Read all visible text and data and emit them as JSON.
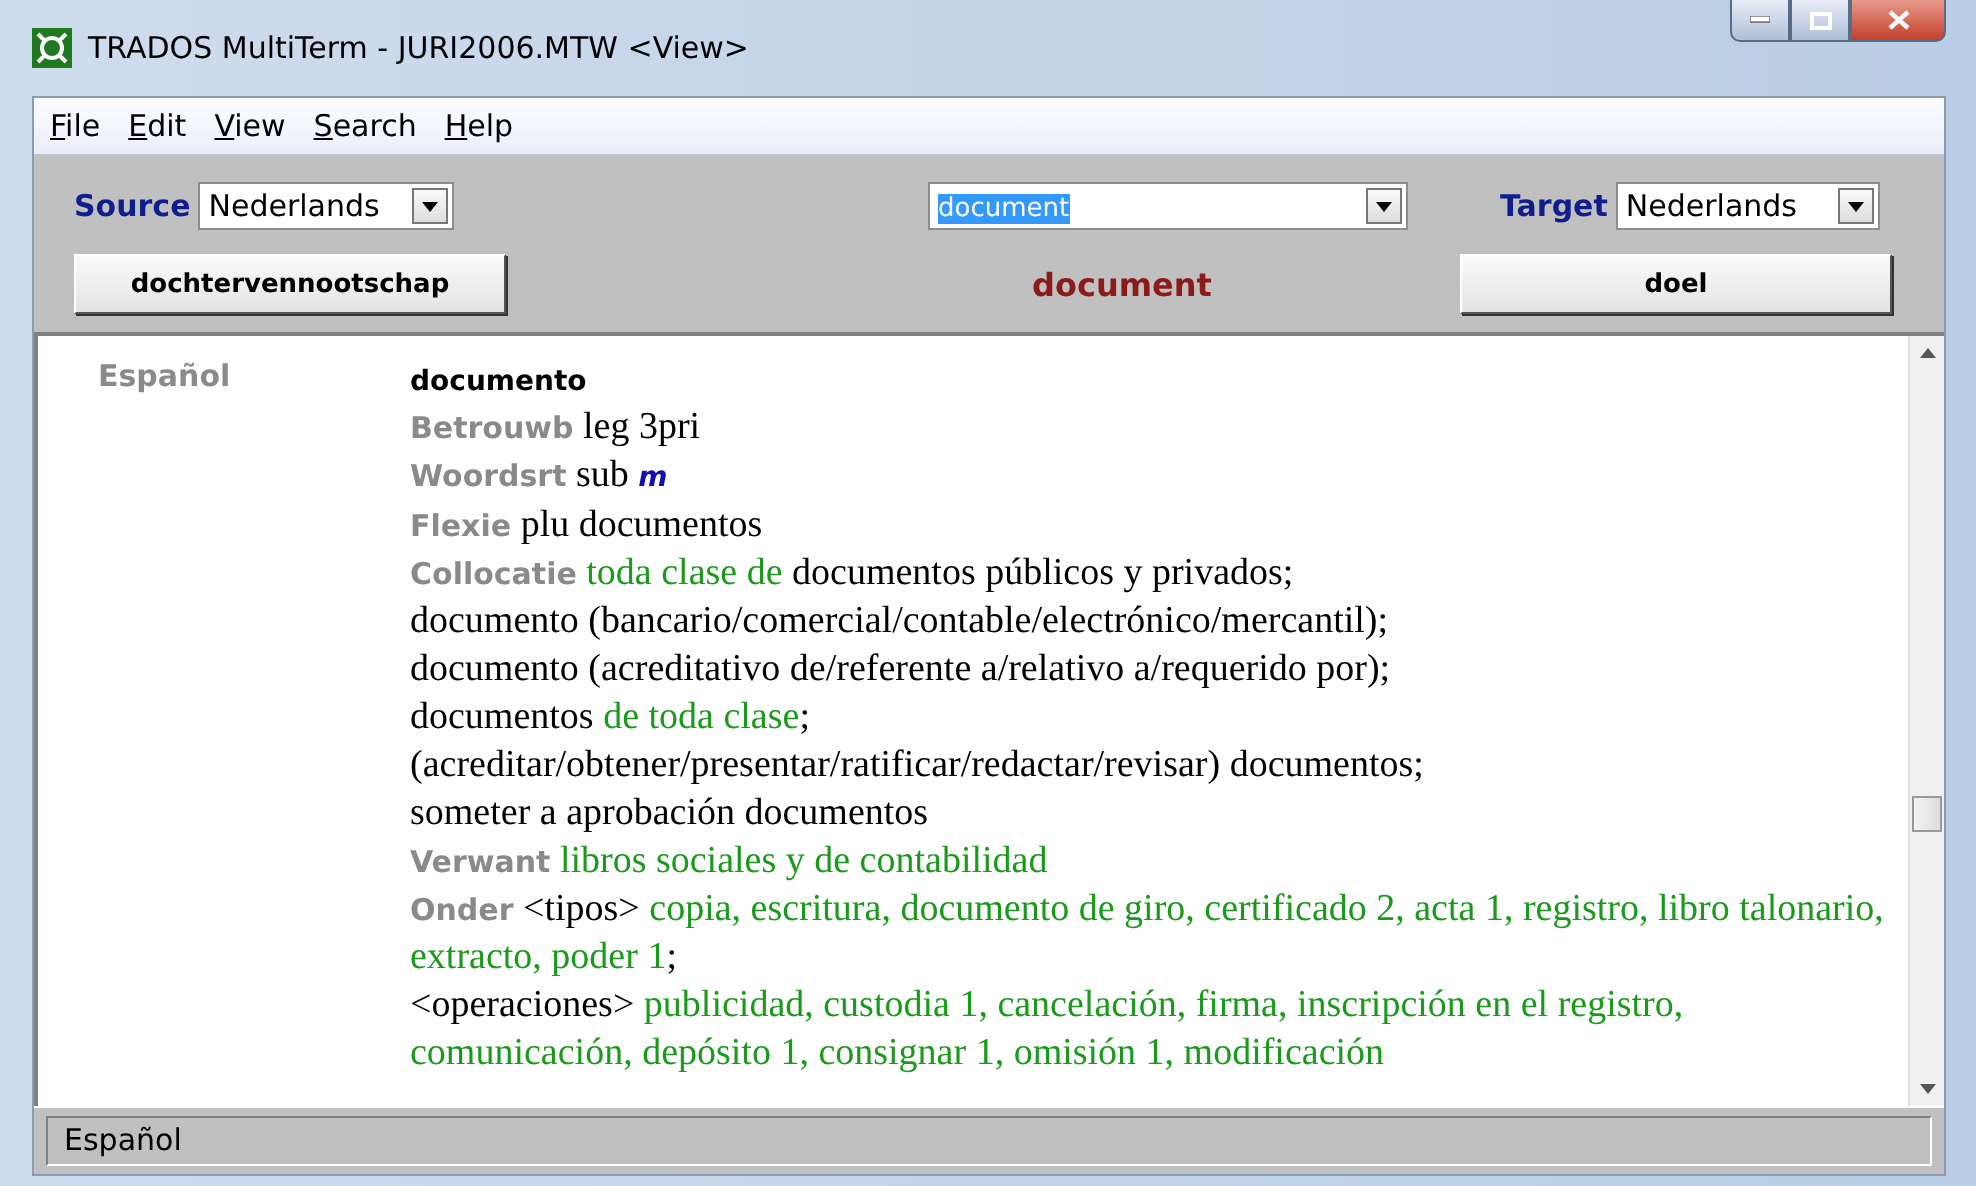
{
  "window": {
    "title": "TRADOS MultiTerm - JURI2006.MTW <View>"
  },
  "menu": [
    {
      "label": "File"
    },
    {
      "label": "Edit"
    },
    {
      "label": "View"
    },
    {
      "label": "Search"
    },
    {
      "label": "Help"
    }
  ],
  "toolbar": {
    "source_label": "Source",
    "source": "Nederlands",
    "search": "document",
    "target_label": "Target",
    "target": "Nederlands",
    "previous": "dochtervennootschap",
    "current": "document",
    "next": "doel"
  },
  "entry": {
    "language": "Español",
    "lines": [
      {
        "segments": [
          {
            "kind": "headword",
            "text": "documento"
          }
        ]
      },
      {
        "label": "Betrouwb",
        "segments": [
          {
            "kind": "plain",
            "text": "leg 3pri"
          }
        ]
      },
      {
        "label": "Woordsrt",
        "segments": [
          {
            "kind": "plain",
            "text": "sub "
          },
          {
            "kind": "gram",
            "text": "m"
          }
        ]
      },
      {
        "label": "Flexie",
        "segments": [
          {
            "kind": "plain",
            "text": "plu documentos"
          }
        ]
      },
      {
        "label": "Collocatie",
        "segments": [
          {
            "kind": "term",
            "text": "toda clase de"
          },
          {
            "kind": "plain",
            "text": " documentos públicos y privados;"
          }
        ]
      },
      {
        "segments": [
          {
            "kind": "plain",
            "text": "documento (bancario/comercial/contable/electrónico/mercantil);"
          }
        ]
      },
      {
        "segments": [
          {
            "kind": "plain",
            "text": "documento (acreditativo de/referente a/relativo a/requerido por);"
          }
        ]
      },
      {
        "segments": [
          {
            "kind": "plain",
            "text": "documentos "
          },
          {
            "kind": "term",
            "text": "de toda clase"
          },
          {
            "kind": "plain",
            "text": ";"
          }
        ]
      },
      {
        "segments": [
          {
            "kind": "plain",
            "text": "(acreditar/obtener/presentar/ratificar/redactar/revisar) documentos;"
          }
        ]
      },
      {
        "segments": [
          {
            "kind": "plain",
            "text": "someter a aprobación documentos"
          }
        ]
      },
      {
        "label": "Verwant",
        "segments": [
          {
            "kind": "term",
            "text": "libros sociales y de contabilidad"
          }
        ]
      },
      {
        "label": "Onder",
        "segments": [
          {
            "kind": "plain",
            "text": "<tipos> "
          },
          {
            "kind": "term",
            "text": "copia, escritura, documento de giro, certificado 2, acta 1, registro, libro talonario, extracto, poder 1"
          },
          {
            "kind": "plain",
            "text": ";"
          }
        ]
      },
      {
        "segments": [
          {
            "kind": "plain",
            "text": "<operaciones> "
          },
          {
            "kind": "term",
            "text": "publicidad, custodia 1, cancelación, firma, inscripción en el registro, comunicación, depósito 1, consignar 1, omisión 1, modificación"
          }
        ]
      }
    ]
  },
  "status_bar": {
    "text": "Español"
  }
}
